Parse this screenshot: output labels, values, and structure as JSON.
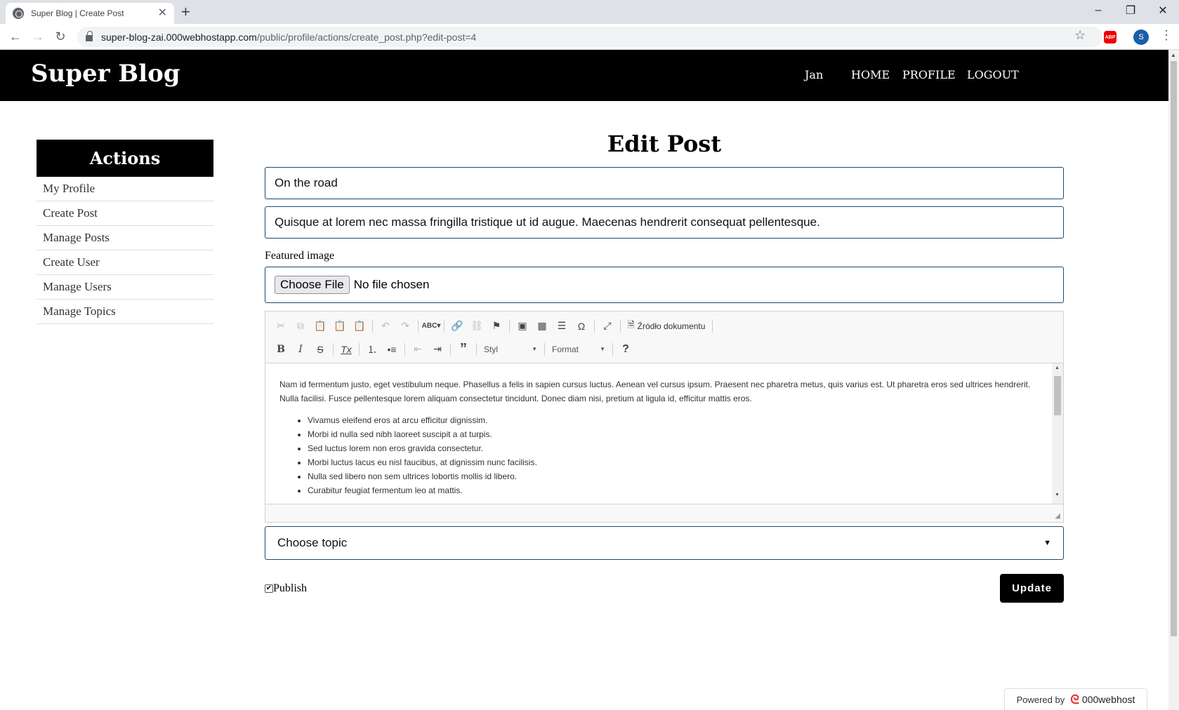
{
  "browser": {
    "tab_title": "Super Blog | Create Post",
    "url_host": "super-blog-zai.000webhostapp.com",
    "url_path": "/public/profile/actions/create_post.php?edit-post=4",
    "abp_label": "ABP",
    "profile_initial": "S"
  },
  "header": {
    "logo": "Super Blog",
    "user": "Jan",
    "nav": [
      "HOME",
      "PROFILE",
      "LOGOUT"
    ]
  },
  "sidebar": {
    "title": "Actions",
    "items": [
      "My Profile",
      "Create Post",
      "Manage Posts",
      "Create User",
      "Manage Users",
      "Manage Topics"
    ]
  },
  "form": {
    "page_title": "Edit Post",
    "title_value": "On the road",
    "excerpt_value": "Quisque at lorem nec massa fringilla tristique ut id augue. Maecenas hendrerit consequat pellentesque.",
    "featured_label": "Featured image",
    "file_button": "Choose File",
    "file_status": "No file chosen",
    "topic_value": "Choose topic",
    "publish_label": "Publish",
    "publish_checked": true,
    "update_label": "Update"
  },
  "editor": {
    "source_label": "Źródło dokumentu",
    "style_label": "Styl",
    "format_label": "Format",
    "paragraph": "Nam id fermentum justo, eget vestibulum neque. Phasellus a felis in sapien cursus luctus. Aenean vel cursus ipsum. Praesent nec pharetra metus, quis varius est. Ut pharetra eros sed ultrices hendrerit. Nulla facilisi. Fusce pellentesque lorem aliquam consectetur tincidunt. Donec diam nisi, pretium at ligula id, efficitur mattis eros.",
    "list": [
      "Vivamus eleifend eros at arcu efficitur dignissim.",
      "Morbi id nulla sed nibh laoreet suscipit a at turpis.",
      "Sed luctus lorem non eros gravida consectetur.",
      "Morbi luctus lacus eu nisl faucibus, at dignissim nunc facilisis.",
      "Nulla sed libero non sem ultrices lobortis mollis id libero.",
      "Curabitur feugiat fermentum leo at mattis."
    ]
  },
  "footer": {
    "powered_by": "Powered by",
    "brand": "000webhost"
  }
}
